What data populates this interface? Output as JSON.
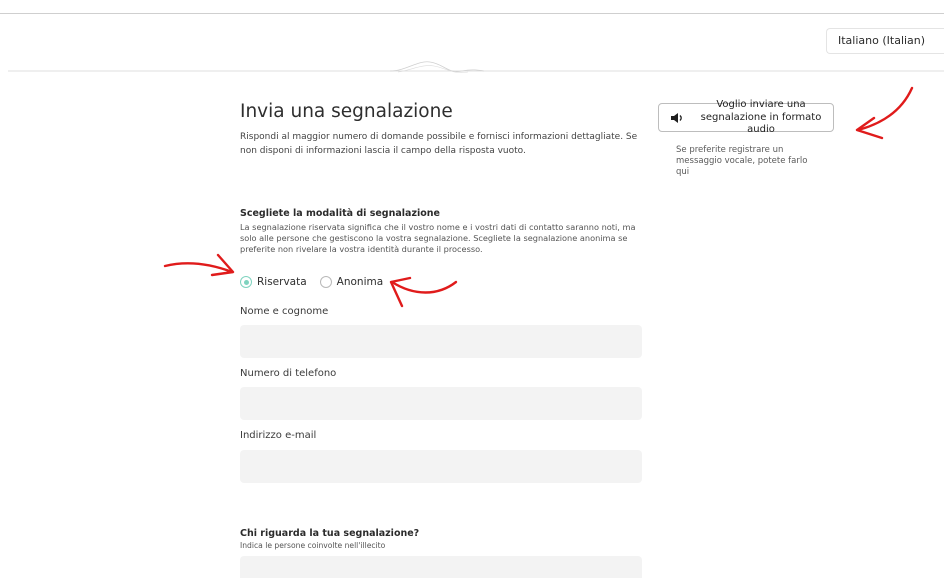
{
  "language_selector": {
    "value": "Italiano (Italian)"
  },
  "form": {
    "title": "Invia una segnalazione",
    "intro": "Rispondi al maggior numero di domande possibile e fornisci informazioni dettagliate. Se non disponi di informazioni lascia il campo della risposta vuoto."
  },
  "audio": {
    "button_label": "Voglio inviare una segnalazione in formato audio",
    "help_text": "Se preferite registrare un messaggio vocale, potete farlo qui",
    "icon": "speaker-icon"
  },
  "mode": {
    "title": "Scegliete la modalità di segnalazione",
    "description": "La segnalazione riservata significa che il vostro nome e i vostri dati di contatto saranno noti, ma solo alle persone che gestiscono la vostra segnalazione. Scegliete la segnalazione anonima se preferite non rivelare la vostra identità durante il processo.",
    "options": [
      {
        "label": "Riservata",
        "selected": true
      },
      {
        "label": "Anonima",
        "selected": false
      }
    ],
    "accent_color": "#7fd3bf"
  },
  "fields": [
    {
      "label": "Nome e cognome",
      "value": ""
    },
    {
      "label": "Numero di telefono",
      "value": ""
    },
    {
      "label": "Indirizzo e-mail",
      "value": ""
    }
  ],
  "involved": {
    "title": "Chi riguarda la tua segnalazione?",
    "description": "Indica le persone coinvolte nell'illecito"
  },
  "annotation_color": "#e01b1b"
}
